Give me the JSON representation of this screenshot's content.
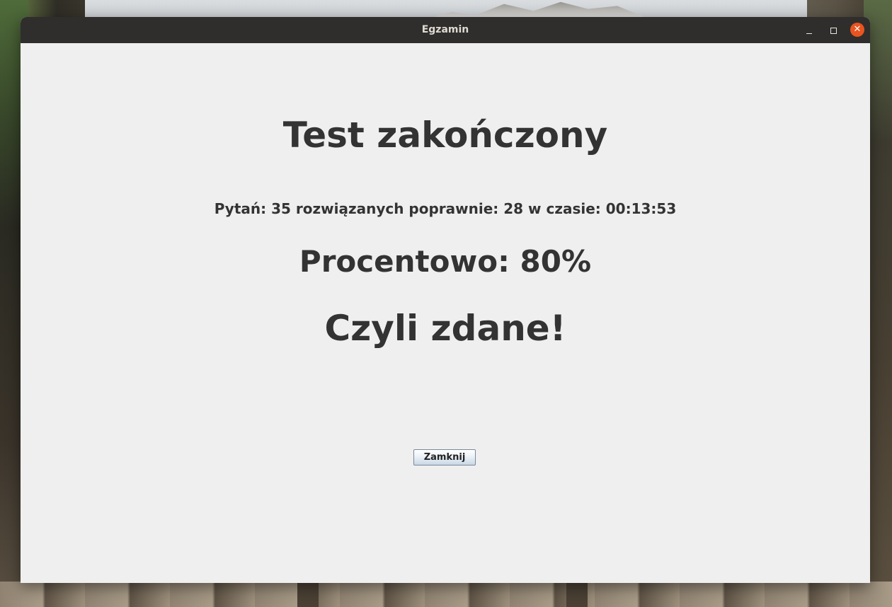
{
  "window": {
    "title": "Egzamin"
  },
  "result": {
    "heading": "Test zakończony",
    "stats": "Pytań: 35 rozwiązanych poprawnie: 28 w czasie: 00:13:53",
    "percent": "Procentowo: 80%",
    "verdict": "Czyli zdane!"
  },
  "actions": {
    "close_label": "Zamknij"
  },
  "icons": {
    "minimize": "minimize-icon",
    "maximize": "maximize-icon",
    "close": "close-icon"
  },
  "colors": {
    "titlebar": "#2f2e2c",
    "window_bg": "#efefef",
    "close_accent": "#e95420",
    "text": "#333333"
  }
}
